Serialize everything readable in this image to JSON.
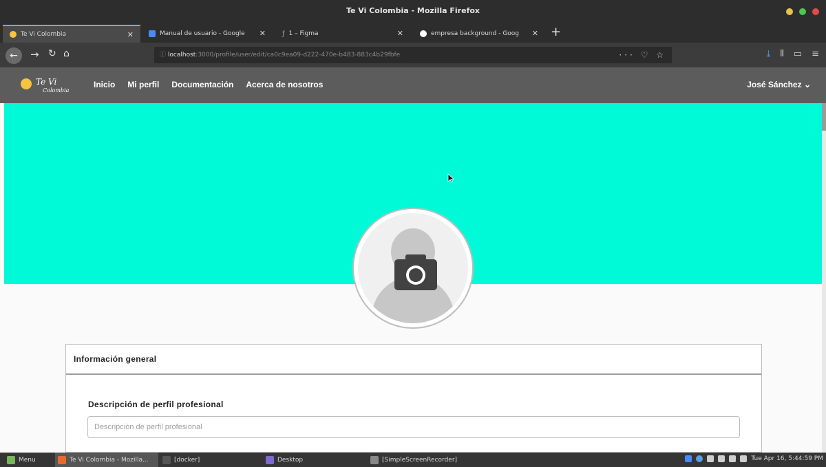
{
  "window": {
    "title": "Te Vi Colombia - Mozilla Firefox",
    "controls": [
      "#e8c24a",
      "#4cc94c",
      "#e04a4a"
    ]
  },
  "tabs": [
    {
      "label": "Te Vi Colombia",
      "favicon_color": "#f5c542",
      "active": true
    },
    {
      "label": "Manual de usuario - Google",
      "favicon_color": "#4a8af4",
      "active": false
    },
    {
      "label": "1 – Figma",
      "favicon_color": "#a0a0a0",
      "active": false
    },
    {
      "label": "empresa background - Goog",
      "favicon_color": "#ffffff",
      "active": false
    }
  ],
  "new_tab_label": "+",
  "address_bar": {
    "host": "localhost",
    "path": ":3000/profile/user/edit/ca0c9ea09-d222-470e-b483-883c4b29fbfe",
    "actions": "··· ♡ ☆"
  },
  "app": {
    "logo_main": "Te Vi",
    "logo_sub": "Colombia",
    "nav": [
      "Inicio",
      "Mi perfil",
      "Documentación",
      "Acerca de nosotros"
    ],
    "user_name": "José Sánchez"
  },
  "colors": {
    "hero": "#00fad8",
    "header": "#5c5c5c"
  },
  "card": {
    "title": "Información general",
    "field_label": "Descripción de perfil profesional",
    "field_placeholder": "Descripción de perfil profesional",
    "field_value": ""
  },
  "taskbar": {
    "menu": "Menu",
    "items": [
      "Te Vi Colombia - Mozilla...",
      "[docker]",
      "Desktop",
      "[SimpleScreenRecorder]"
    ],
    "clock": "Tue Apr 16, 5:44:59 PM"
  }
}
